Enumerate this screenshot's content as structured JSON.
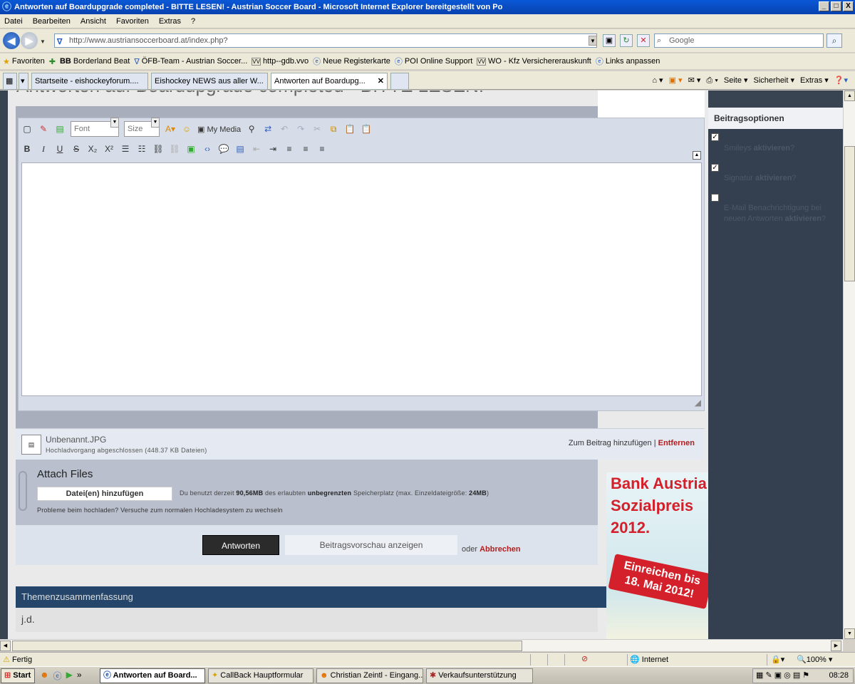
{
  "window": {
    "title": "Antworten auf Boardupgrade completed - BITTE LESEN! - Austrian Soccer Board - Microsoft Internet Explorer bereitgestellt von Po",
    "controls": [
      "_",
      "□",
      "X"
    ]
  },
  "menu": [
    "Datei",
    "Bearbeiten",
    "Ansicht",
    "Favoriten",
    "Extras",
    "?"
  ],
  "address": {
    "url_host": "http://www.austriansoccerboard.at",
    "url_path": "/index.php?",
    "search_placeholder": "Google"
  },
  "favorites": {
    "label": "Favoriten",
    "items": [
      "Borderland Beat",
      "ÖFB-Team - Austrian Soccer...",
      "http--gdb.vvo",
      "Neue Registerkarte",
      "POI Online Support",
      "WO - Kfz Versichererauskunft",
      "Links anpassen"
    ]
  },
  "tabs": [
    "Startseite - eishockeyforum....",
    "Eishockey NEWS aus aller W...",
    "Antworten auf Boardupg..."
  ],
  "commands": [
    "Seite ▾",
    "Sicherheit ▾",
    "Extras ▾"
  ],
  "page": {
    "heading": "Antworten auf Boardupgrade completed - BITTE LESEN!",
    "editor": {
      "font_placeholder": "Font",
      "size_placeholder": "Size",
      "my_media": "My Media"
    },
    "attachment": {
      "filename": "Unbenannt.JPG",
      "status": "Hochladvorgang abgeschlossen (448.37 KB Dateien)",
      "add_to_post": "Zum Beitrag hinzufügen",
      "separator": "|",
      "remove": "Entfernen"
    },
    "attach_files": {
      "title": "Attach Files",
      "add_button": "Datei(en) hinzufügen",
      "quota_prefix": "Du benutzt derzeit",
      "quota_used": "90,56MB",
      "quota_mid": "des erlaubten",
      "quota_limit": "unbegrenzten",
      "quota_suffix": "Speicherplatz (max. Einzeldateigröße:",
      "quota_max": "24MB",
      "quota_end": ")",
      "switch_note": "Probleme beim hochladen? Versuche zum normalen Hochladesystem zu wechseln"
    },
    "actions": {
      "reply": "Antworten",
      "preview": "Beitragsvorschau anzeigen",
      "or": "oder",
      "cancel": "Abbrechen"
    },
    "topic_summary": {
      "title": "Themenzusammenfassung",
      "first": "j.d."
    },
    "sidebar": {
      "title": "Beitragsoptionen",
      "options": [
        {
          "pre": "Smileys",
          "bold": "aktivieren",
          "post": "?",
          "checked": true
        },
        {
          "pre": "Signatur",
          "bold": "aktivieren",
          "post": "?",
          "checked": true
        },
        {
          "pre": "E-Mail Benachrichtigung bei neuen Antworten",
          "bold": "aktivieren",
          "post": "?",
          "checked": false
        }
      ]
    },
    "ad": {
      "lines": [
        "Bank Austria",
        "Sozialpreis",
        "2012."
      ],
      "ribbon_line1": "Einreichen bis",
      "ribbon_line2": "18. Mai 2012!"
    }
  },
  "statusbar": {
    "status": "Fertig",
    "zone": "Internet",
    "zoom": "100%"
  },
  "taskbar": {
    "start": "Start",
    "items": [
      "Antworten auf Board...",
      "CallBack Hauptformular",
      "Christian Zeintl - Eingang...",
      "Verkaufsunterstützung"
    ],
    "clock": "08:28"
  }
}
